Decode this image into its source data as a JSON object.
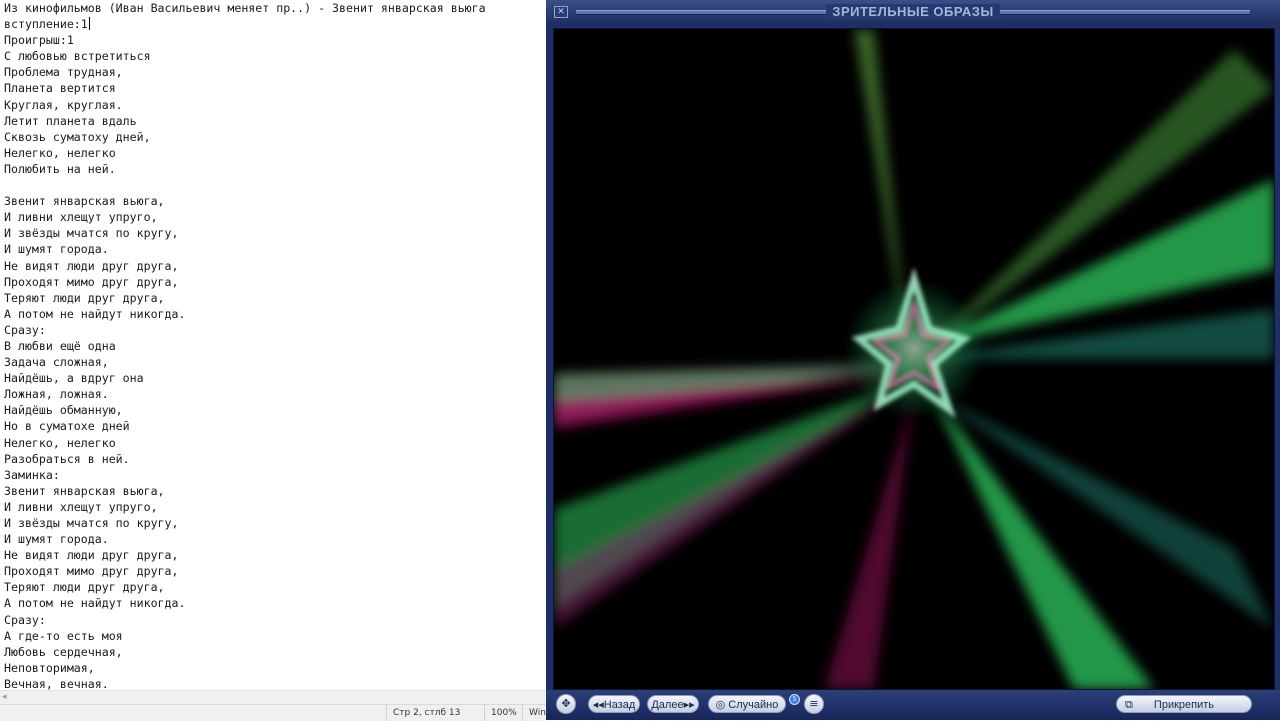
{
  "editor": {
    "lines": [
      "Из кинофильмов (Иван Васильевич меняет пр..) - Звенит январская вьюга",
      "вступление:1",
      "Проигрыш:1",
      "С любовью встретиться",
      "Проблема трудная,",
      "Планета вертится",
      "Круглая, круглая.",
      "Летит планета вдаль",
      "Сквозь суматоху дней,",
      "Нелегко, нелегко",
      "Полюбить на ней.",
      "",
      "Звенит январская вьюга,",
      "И ливни хлещут упруго,",
      "И звёзды мчатся по кругу,",
      "И шумят города.",
      "Не видят люди друг друга,",
      "Проходят мимо друг друга,",
      "Теряют люди друг друга,",
      "А потом не найдут никогда.",
      "Сразу:",
      "В любви ещё одна",
      "Задача сложная,",
      "Найдёшь, а вдруг она",
      "Ложная, ложная.",
      "Найдёшь обманную,",
      "Но в суматохе дней",
      "Нелегко, нелегко",
      "Разобраться в ней.",
      "Заминка:",
      "Звенит январская вьюга,",
      "И ливни хлещут упруго,",
      "И звёзды мчатся по кругу,",
      "И шумят города.",
      "Не видят люди друг друга,",
      "Проходят мимо друг друга,",
      "Теряют люди друг друга,",
      "А потом не найдут никогда.",
      "Сразу:",
      "А где-то есть моя",
      "Любовь сердечная,",
      "Неповторимая,",
      "Вечная, вечная."
    ]
  },
  "statusbar": {
    "position": "Стр 2, стлб 13",
    "zoom": "100%",
    "line_ending": "Windows (CRLF)"
  },
  "visualizer": {
    "title": "ЗРИТЕЛЬНЫЕ ОБРАЗЫ",
    "close_glyph": "✕",
    "nav_glyph": "✥",
    "menu_glyph": "≡",
    "badge": "5",
    "back_label": "◂◂Назад",
    "next_label": "Далее▸▸",
    "random_label": "◎ Случайно",
    "attach_label": "Прикрепить",
    "attach_glyph": "⧉",
    "colors": {
      "frame": "#1d2f66",
      "stage": "#000000",
      "ray_green": "#3dff7a",
      "ray_magenta": "#c01070",
      "ray_cyan": "#40ffe0"
    }
  }
}
